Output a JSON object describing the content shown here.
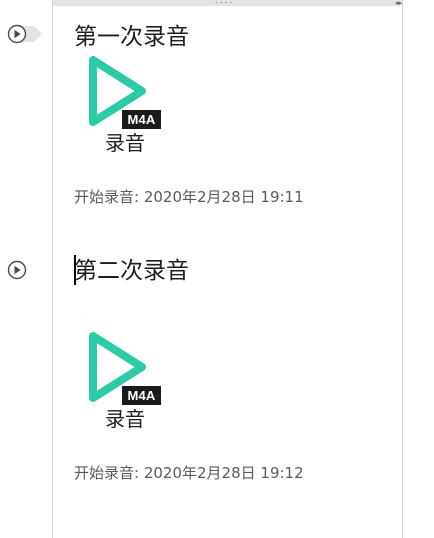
{
  "window": {
    "toolbar_grip": "····",
    "toolbar_arrows": "◂▸"
  },
  "colors": {
    "play_icon": "#2ec9a7",
    "badge_bg": "#1b1b1b",
    "text": "#1f1f1f",
    "timestamp_text": "#5b5b5b",
    "rule": "#d4d4d4"
  },
  "sections": [
    {
      "title": "第一次录音",
      "attachment": {
        "icon": "m4a-audio-file-icon",
        "badge": "M4A",
        "label": "录音"
      },
      "timestamp": "开始录音: 2020年2月28日 19:11"
    },
    {
      "title": "第二次录音",
      "attachment": {
        "icon": "m4a-audio-file-icon",
        "badge": "M4A",
        "label": "录音"
      },
      "timestamp": "开始录音: 2020年2月28日 19:12"
    }
  ]
}
